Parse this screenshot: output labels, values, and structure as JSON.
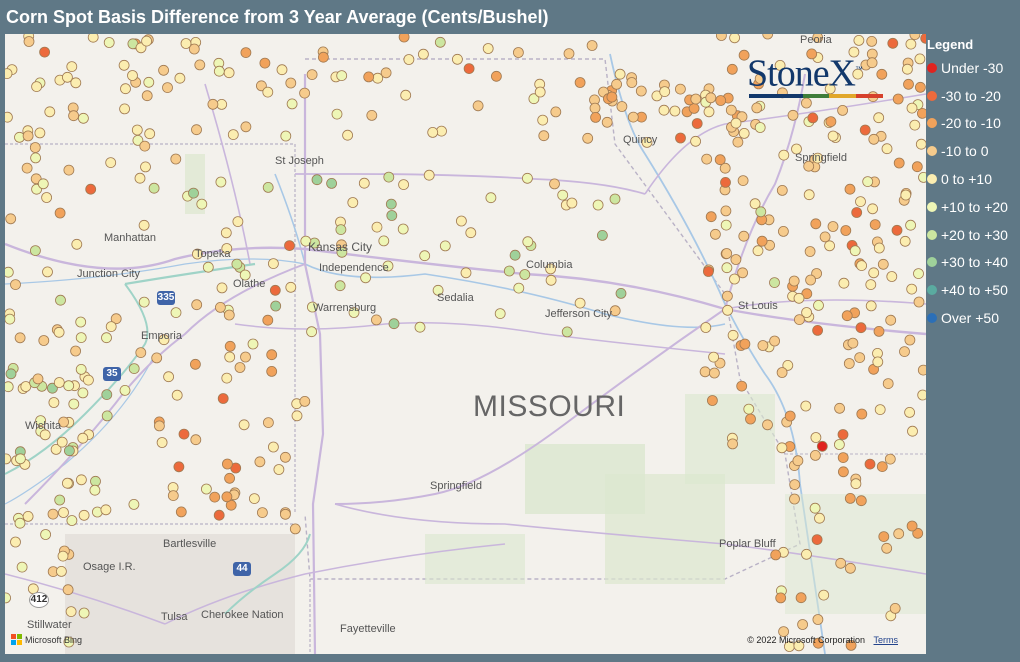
{
  "title": "Corn Spot Basis Difference from 3 Year Average (Cents/Bushel)",
  "legend": {
    "title": "Legend",
    "items": [
      {
        "label": "Under -30",
        "color": "#e0231f"
      },
      {
        "label": "-30 to -20",
        "color": "#ec6a3c"
      },
      {
        "label": "-20 to -10",
        "color": "#f1a25b"
      },
      {
        "label": "-10 to 0",
        "color": "#f6cb8c"
      },
      {
        "label": "0 to +10",
        "color": "#fbedb0"
      },
      {
        "label": "+10 to +20",
        "color": "#eef6b6"
      },
      {
        "label": "+20 to +30",
        "color": "#cce6a0"
      },
      {
        "label": "+30 to +40",
        "color": "#9fd19a"
      },
      {
        "label": "+40 to +50",
        "color": "#5aaba0"
      },
      {
        "label": "Over +50",
        "color": "#2b6fb7"
      }
    ]
  },
  "logo": {
    "text": "StoneX",
    "tm": "™"
  },
  "map": {
    "state_label": "MISSOURI",
    "places": [
      "Peoria",
      "Quincy",
      "Springfield",
      "St Joseph",
      "Manhattan",
      "Topeka",
      "Junction City",
      "Kansas City",
      "Independence",
      "Olathe",
      "Columbia",
      "Warrensburg",
      "Sedalia",
      "Jefferson City",
      "St Louis",
      "Emporia",
      "Wichita",
      "Springfield",
      "Bartlesville",
      "Osage I.R.",
      "Poplar Bluff",
      "Stillwater",
      "Tulsa",
      "Cherokee Nation",
      "Fayetteville"
    ],
    "shields": [
      "335",
      "35",
      "44",
      "412"
    ]
  },
  "attribution": {
    "bing": "Microsoft Bing",
    "copyright": "© 2022 Microsoft Corporation",
    "terms": "Terms"
  }
}
